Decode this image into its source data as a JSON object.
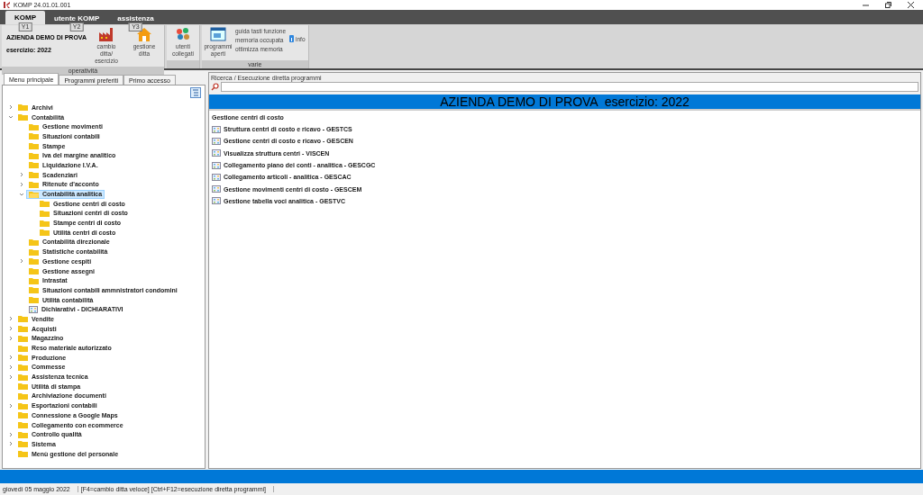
{
  "window": {
    "title": "KOMP 24.01.01.001"
  },
  "ribbon_tabs": [
    {
      "label": "KOMP",
      "keytip": "Y1",
      "selected": true
    },
    {
      "label": "utente KOMP",
      "keytip": "Y2",
      "selected": false
    },
    {
      "label": "assistenza",
      "keytip": "Y3",
      "selected": false
    }
  ],
  "ribbon_groups": [
    {
      "caption": "operatività",
      "company": "AZIENDA DEMO DI PROVA",
      "year": "esercizio: 2022",
      "buttons": [
        {
          "label": "cambio ditta/ esercizio"
        },
        {
          "label": "gestione ditta"
        }
      ]
    },
    {
      "buttons": [
        {
          "label": "utenti collegati"
        }
      ]
    },
    {
      "caption": "varie",
      "buttons": [
        {
          "label": "programmi aperti"
        }
      ],
      "links": [
        "guida tasti funzione",
        "memoria occupata",
        "ottimizza memoria"
      ],
      "info": "info"
    }
  ],
  "side_tabs": [
    {
      "label": "Menu principale",
      "selected": true
    },
    {
      "label": "Programmi preferiti",
      "selected": false
    },
    {
      "label": "Primo accesso",
      "selected": false
    }
  ],
  "tree": [
    {
      "label": "Archivi",
      "kind": "folder",
      "expanded": false,
      "selected": false
    },
    {
      "label": "Contabilità",
      "kind": "folder",
      "expanded": true,
      "selected": false,
      "children": [
        {
          "label": "Gestione movimenti",
          "kind": "folder",
          "selected": false
        },
        {
          "label": "Situazioni contabili",
          "kind": "folder",
          "selected": false
        },
        {
          "label": "Stampe",
          "kind": "folder",
          "selected": false
        },
        {
          "label": "Iva del margine analitico",
          "kind": "folder",
          "selected": false
        },
        {
          "label": "Liquidazione I.V.A.",
          "kind": "folder",
          "selected": false
        },
        {
          "label": "Scadenziari",
          "kind": "folder",
          "expanded": false,
          "selected": false
        },
        {
          "label": "Ritenute d'acconto",
          "kind": "folder",
          "expanded": false,
          "selected": false
        },
        {
          "label": "Contabilità analitica",
          "kind": "folder",
          "expanded": true,
          "selected": true,
          "children": [
            {
              "label": "Gestione centri di costo",
              "kind": "folder",
              "selected": false
            },
            {
              "label": "Situazioni centri di costo",
              "kind": "folder",
              "selected": false
            },
            {
              "label": "Stampe centri di costo",
              "kind": "folder",
              "selected": false
            },
            {
              "label": "Utilità centri di costo",
              "kind": "folder",
              "selected": false
            }
          ]
        },
        {
          "label": "Contabilità direzionale",
          "kind": "folder",
          "selected": false
        },
        {
          "label": "Statistiche contabilità",
          "kind": "folder",
          "selected": false
        },
        {
          "label": "Gestione cespiti",
          "kind": "folder",
          "expanded": false,
          "selected": false
        },
        {
          "label": "Gestione assegni",
          "kind": "folder",
          "selected": false
        },
        {
          "label": "Intrastat",
          "kind": "folder",
          "selected": false
        },
        {
          "label": "Situazioni contabili ammnistratori condomini",
          "kind": "folder",
          "selected": false
        },
        {
          "label": "Utilità contabilità",
          "kind": "folder",
          "selected": false
        },
        {
          "label": "Dichiarativi - DICHIARATIVI",
          "kind": "program",
          "selected": false
        }
      ]
    },
    {
      "label": "Vendite",
      "kind": "folder",
      "expanded": false,
      "selected": false
    },
    {
      "label": "Acquisti",
      "kind": "folder",
      "expanded": false,
      "selected": false
    },
    {
      "label": "Magazzino",
      "kind": "folder",
      "expanded": false,
      "selected": false
    },
    {
      "label": "Reso materiale autorizzato",
      "kind": "folder",
      "selected": false
    },
    {
      "label": "Produzione",
      "kind": "folder",
      "expanded": false,
      "selected": false
    },
    {
      "label": "Commesse",
      "kind": "folder",
      "expanded": false,
      "selected": false
    },
    {
      "label": "Assistenza tecnica",
      "kind": "folder",
      "expanded": false,
      "selected": false
    },
    {
      "label": "Utilità di stampa",
      "kind": "folder",
      "selected": false
    },
    {
      "label": "Archiviazione documenti",
      "kind": "folder",
      "selected": false
    },
    {
      "label": "Esportazioni contabili",
      "kind": "folder",
      "expanded": false,
      "selected": false
    },
    {
      "label": "Connessione a Google Maps",
      "kind": "folder",
      "selected": false
    },
    {
      "label": "Collegamento con ecommerce",
      "kind": "folder",
      "selected": false
    },
    {
      "label": "Controllo qualità",
      "kind": "folder",
      "expanded": false,
      "selected": false
    },
    {
      "label": "Sistema",
      "kind": "folder",
      "expanded": false,
      "selected": false
    },
    {
      "label": "Menù gestione del personale",
      "kind": "folder",
      "selected": false
    }
  ],
  "search": {
    "label": "Ricerca / Esecuzione diretta programmi"
  },
  "banner": "AZIENDA DEMO DI PROVA  esercizio: 2022",
  "section": {
    "title": "Gestione centri di costo",
    "programs": [
      "Struttura centri di costo e ricavo - GESTCS",
      "Gestione centri di costo e ricavo - GESCEN",
      "Visualizza struttura centri - VISCEN",
      "Collegamento piano dei conti - analitica - GESCGC",
      "Collegamento articoli - analitica - GESCAC",
      "Gestione movimenti centri di costo - GESCEM",
      "Gestione tabella voci analitica - GESTVC"
    ]
  },
  "status_bar": [
    "giovedì 05 maggio 2022",
    "[F4=cambio ditta veloce] [Ctrl+F12=esecuzione diretta programmi]"
  ]
}
